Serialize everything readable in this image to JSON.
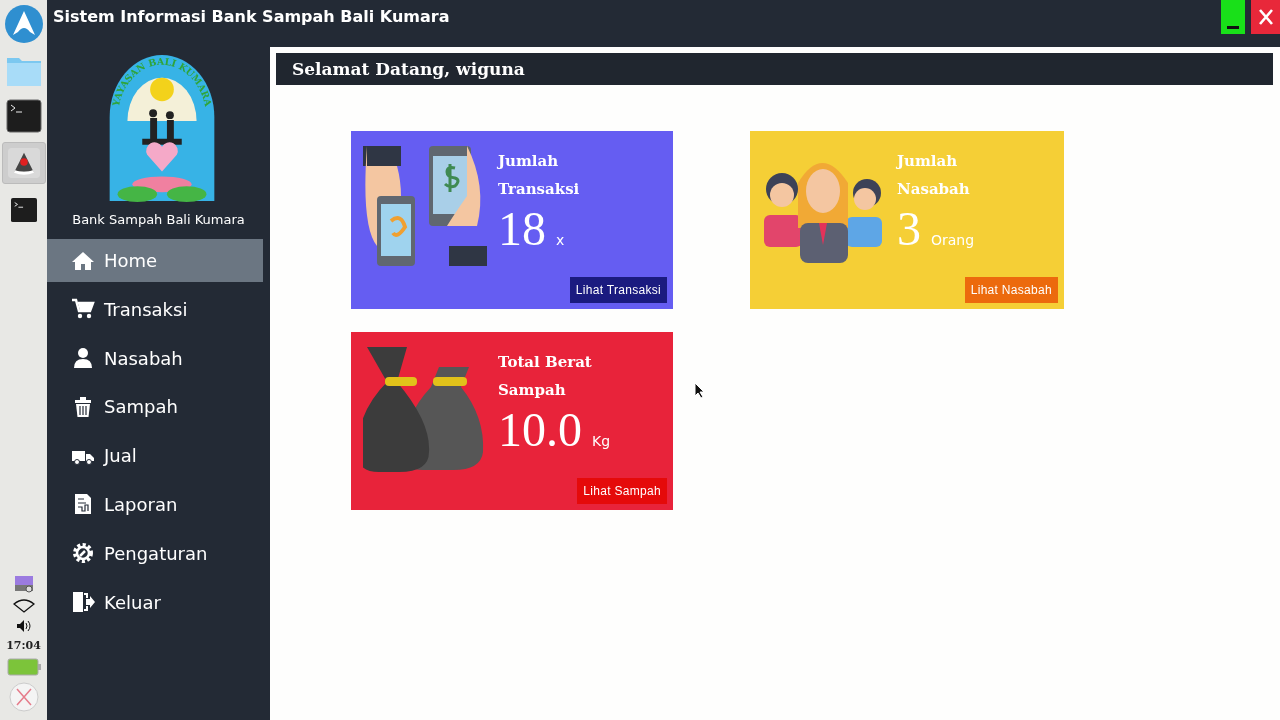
{
  "window": {
    "title": "Sistem Informasi Bank Sampah Bali Kumara"
  },
  "dock": {
    "apps": [
      {
        "kind": "folder",
        "selected": false
      },
      {
        "kind": "terminal",
        "selected": false
      },
      {
        "kind": "java",
        "selected": true
      },
      {
        "kind": "terminal-small",
        "selected": false
      }
    ],
    "clock": "17:04"
  },
  "sidebar": {
    "logo_text": "YAYASAN BALI KUMARA",
    "caption": "Bank Sampah Bali Kumara",
    "items": [
      {
        "kind": "home",
        "label": "Home",
        "selected": true
      },
      {
        "kind": "cart",
        "label": "Transaksi",
        "selected": false
      },
      {
        "kind": "user",
        "label": "Nasabah",
        "selected": false
      },
      {
        "kind": "trash",
        "label": "Sampah",
        "selected": false
      },
      {
        "kind": "truck",
        "label": "Jual",
        "selected": false
      },
      {
        "kind": "report",
        "label": "Laporan",
        "selected": false
      },
      {
        "kind": "gear",
        "label": "Pengaturan",
        "selected": false
      },
      {
        "kind": "exit",
        "label": "Keluar",
        "selected": false
      }
    ]
  },
  "header": {
    "greeting": "Selamat Datang, wiguna"
  },
  "cards": [
    {
      "kind": "transactions",
      "title": "Jumlah Transaksi",
      "value": "18",
      "unit": "x",
      "button": "Lihat Transaksi",
      "color": "#655df2"
    },
    {
      "kind": "customers",
      "title": "Jumlah Nasabah",
      "value": "3",
      "unit": "Orang",
      "button": "Lihat Nasabah",
      "color": "#f5cf36"
    },
    {
      "kind": "waste",
      "title": "Total Berat Sampah",
      "value": "10.0",
      "unit": "Kg",
      "button": "Lihat Sampah",
      "color": "#e8233a"
    }
  ]
}
